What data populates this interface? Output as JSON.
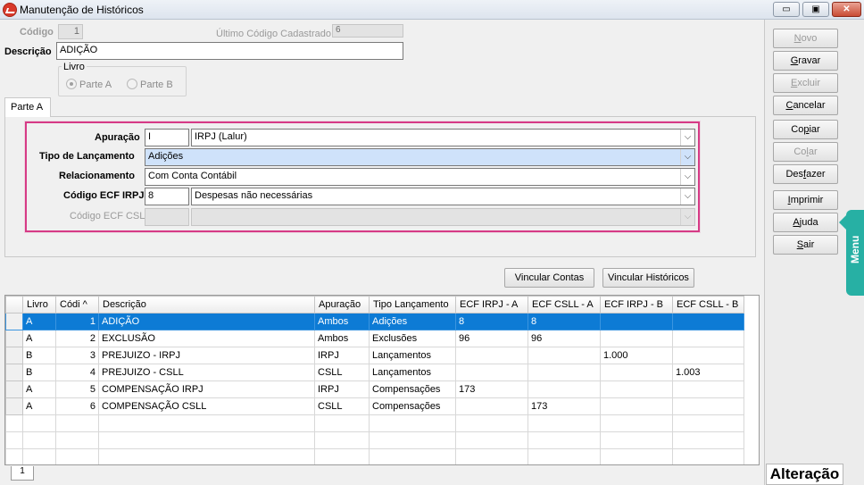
{
  "window": {
    "title": "Manutenção de Históricos",
    "controls": {
      "minimize": "▭",
      "restore": "▣",
      "close": "✕"
    }
  },
  "header": {
    "codigo_label": "Código",
    "codigo_value": "1",
    "ultimo_label": "Último Código Cadastrado:",
    "ultimo_value": "6",
    "descricao_label": "Descrição",
    "descricao_value": "ADIÇÃO",
    "livro": {
      "title": "Livro",
      "options": [
        {
          "label": "Parte A",
          "selected": true
        },
        {
          "label": "Parte B",
          "selected": false
        }
      ]
    }
  },
  "tab_label": "Parte A",
  "form": {
    "apuracao": {
      "label": "Apuração",
      "code": "I",
      "value": "IRPJ (Lalur)"
    },
    "tipo_lancamento": {
      "label": "Tipo de Lançamento",
      "value": "Adições"
    },
    "relacionamento": {
      "label": "Relacionamento",
      "value": "Com Conta Contábil"
    },
    "codigo_ecf_irpj": {
      "label": "Código ECF IRPJ",
      "code": "8",
      "value": "Despesas não necessárias"
    },
    "codigo_ecf_csll": {
      "label": "Código ECF CSLL",
      "code": "",
      "value": ""
    },
    "dropdown_arrow": "⌵"
  },
  "buttons": {
    "vincular_contas": "Vincular Contas",
    "vincular_historicos": "Vincular Históricos"
  },
  "grid": {
    "columns": [
      "Livro",
      "Códi ^",
      "Descrição",
      "Apuração",
      "Tipo Lançamento",
      "ECF IRPJ - A",
      "ECF CSLL - A",
      "ECF IRPJ - B",
      "ECF CSLL - B"
    ],
    "rows": [
      [
        "A",
        "1",
        "ADIÇÃO",
        "Ambos",
        "Adições",
        "8",
        "8",
        "",
        ""
      ],
      [
        "A",
        "2",
        "EXCLUSÃO",
        "Ambos",
        "Exclusões",
        "96",
        "96",
        "",
        ""
      ],
      [
        "B",
        "3",
        "PREJUIZO - IRPJ",
        "IRPJ",
        "Lançamentos",
        "",
        "",
        "1.000",
        ""
      ],
      [
        "B",
        "4",
        "PREJUIZO - CSLL",
        "CSLL",
        "Lançamentos",
        "",
        "",
        "",
        "1.003"
      ],
      [
        "A",
        "5",
        "COMPENSAÇÃO IRPJ",
        "IRPJ",
        "Compensações",
        "173",
        "",
        "",
        ""
      ],
      [
        "A",
        "6",
        "COMPENSAÇÃO CSLL",
        "CSLL",
        "Compensações",
        "",
        "173",
        "",
        ""
      ]
    ],
    "selected_row": 0,
    "page_tab": "1"
  },
  "side_buttons": [
    {
      "key": "novo",
      "pre": "",
      "u": "N",
      "post": "ovo",
      "enabled": false
    },
    {
      "key": "gravar",
      "pre": "",
      "u": "G",
      "post": "ravar",
      "enabled": true
    },
    {
      "key": "excluir",
      "pre": "",
      "u": "E",
      "post": "xcluir",
      "enabled": false
    },
    {
      "key": "cancelar",
      "pre": "",
      "u": "C",
      "post": "ancelar",
      "enabled": true
    },
    {
      "key": "copiar",
      "pre": "Co",
      "u": "p",
      "post": "iar",
      "enabled": true
    },
    {
      "key": "colar",
      "pre": "Co",
      "u": "l",
      "post": "ar",
      "enabled": false
    },
    {
      "key": "desfazer",
      "pre": "Des",
      "u": "f",
      "post": "azer",
      "enabled": true
    },
    {
      "key": "imprimir",
      "pre": "",
      "u": "I",
      "post": "mprimir",
      "enabled": true
    },
    {
      "key": "ajuda",
      "pre": "",
      "u": "A",
      "post": "juda",
      "enabled": true
    },
    {
      "key": "sair",
      "pre": "",
      "u": "S",
      "post": "air",
      "enabled": true
    }
  ],
  "status": "Alteração",
  "menu_tab": "Menu",
  "colors": {
    "selection": "#0d7bd5",
    "highlight_border": "#d63a86",
    "menu_tab": "#27b0a4"
  }
}
